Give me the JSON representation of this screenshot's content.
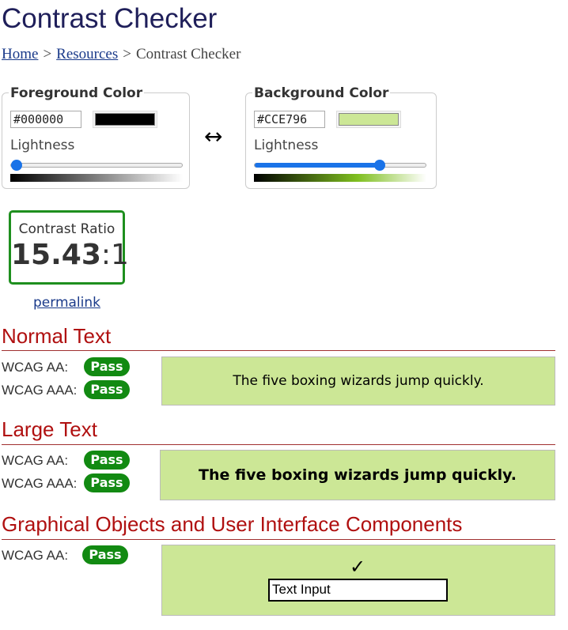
{
  "page": {
    "title": "Contrast Checker"
  },
  "breadcrumb": {
    "home": "Home",
    "sep1": ">",
    "resources": "Resources",
    "sep2": ">",
    "current": "Contrast Checker"
  },
  "foreground": {
    "title": "Foreground Color",
    "hex": "#000000",
    "color": "#000000",
    "lightness_label": "Lightness",
    "lightness": 0.0
  },
  "background": {
    "title": "Background Color",
    "hex": "#CCE796",
    "color": "#CCE796",
    "lightness_label": "Lightness",
    "lightness": 0.74
  },
  "swap_icon": "↔",
  "contrast": {
    "label": "Contrast Ratio",
    "ratio": "15.43",
    "suffix": ":1"
  },
  "permalink": "permalink",
  "normal_text": {
    "title": "Normal Text",
    "aa_label": "WCAG AA:",
    "aa_result": "Pass",
    "aaa_label": "WCAG AAA:",
    "aaa_result": "Pass",
    "sample": "The five boxing wizards jump quickly."
  },
  "large_text": {
    "title": "Large Text",
    "aa_label": "WCAG AA:",
    "aa_result": "Pass",
    "aaa_label": "WCAG AAA:",
    "aaa_result": "Pass",
    "sample": "The five boxing wizards jump quickly."
  },
  "graphical": {
    "title": "Graphical Objects and User Interface Components",
    "aa_label": "WCAG AA:",
    "aa_result": "Pass",
    "check_icon": "✓",
    "input_value": "Text Input"
  },
  "colors": {
    "pass": "#128a12",
    "heading": "#b01010",
    "sample_bg": "#cce796",
    "ratio_border": "#1e8f1e"
  }
}
